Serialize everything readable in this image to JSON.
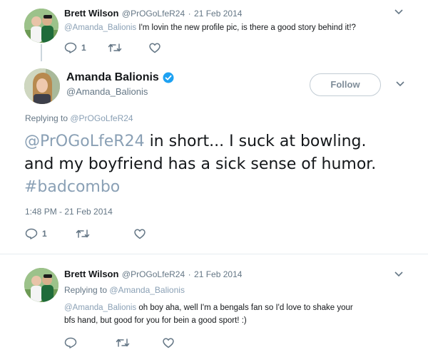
{
  "tweet1": {
    "author_name": "Brett Wilson",
    "author_handle": "@PrOGoLfeR24",
    "sep": "·",
    "date": "21 Feb 2014",
    "mention": "@Amanda_Balionis",
    "text": " I'm lovin the new profile pic, is there a good story behind it!?",
    "reply_count": "1"
  },
  "main_tweet": {
    "author_name": "Amanda Balionis",
    "author_handle": "@Amanda_Balionis",
    "follow_label": "Follow",
    "replying_to_label": "Replying to ",
    "replying_to_handle": "@PrOGoLfeR24",
    "line1_mention": "@PrOGoLfeR24",
    "line1_text": " in short... I suck at bowling.",
    "line2_text": "and my boyfriend has a sick sense of humor.",
    "line3_hashtag": "#badcombo",
    "timestamp": "1:48 PM - 21 Feb 2014",
    "reply_count": "1",
    "verified_color": "#1da1f2"
  },
  "tweet3": {
    "author_name": "Brett Wilson",
    "author_handle": "@PrOGoLfeR24",
    "sep": "·",
    "date": "21 Feb 2014",
    "replying_to_label": "Replying to ",
    "replying_to_handle": "@Amanda_Balionis",
    "mention": "@Amanda_Balionis",
    "text_line1": " oh boy aha, well I'm a bengals fan so I'd love to shake your",
    "text_line2": "bfs hand, but good for you for bein a good sport! :)"
  },
  "icons": [
    "reply-icon",
    "retweet-icon",
    "like-icon",
    "chevron-down-icon",
    "verified-badge-icon"
  ],
  "colors": {
    "accent": "#1da1f2",
    "muted": "#657786",
    "border": "#e6ecf0"
  }
}
